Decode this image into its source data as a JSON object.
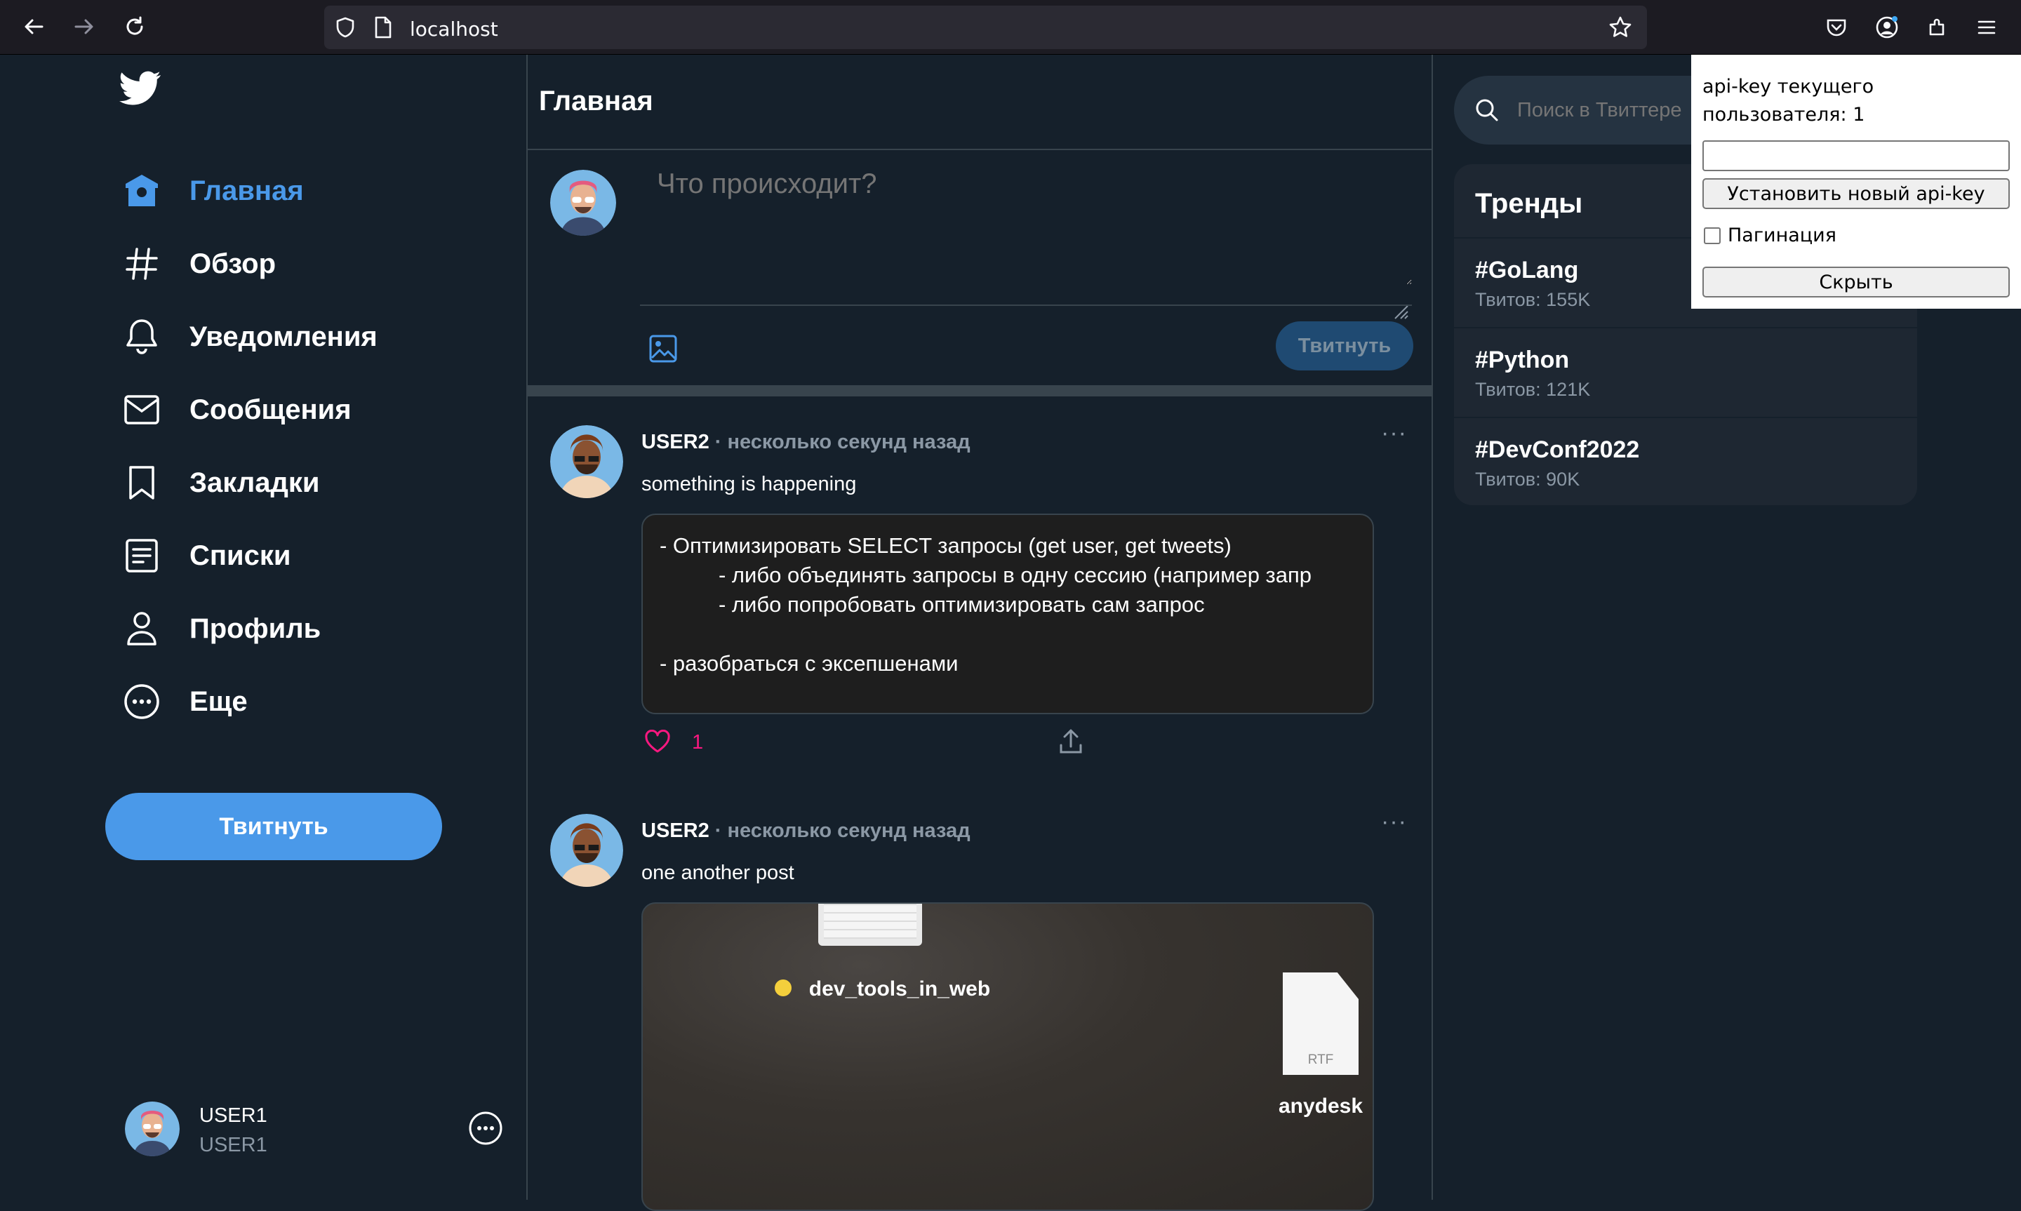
{
  "browser": {
    "url": "localhost"
  },
  "sidebar": {
    "logo_icon": "twitter-bird-icon",
    "items": [
      {
        "label": "Главная",
        "icon": "home-icon",
        "active": true
      },
      {
        "label": "Обзор",
        "icon": "hashtag-icon"
      },
      {
        "label": "Уведомления",
        "icon": "bell-icon"
      },
      {
        "label": "Сообщения",
        "icon": "mail-icon"
      },
      {
        "label": "Закладки",
        "icon": "bookmark-icon"
      },
      {
        "label": "Списки",
        "icon": "list-icon"
      },
      {
        "label": "Профиль",
        "icon": "user-icon"
      },
      {
        "label": "Еще",
        "icon": "more-circle-icon"
      }
    ],
    "tweet_button": "Твитнуть",
    "user": {
      "name": "USER1",
      "handle": "USER1"
    }
  },
  "main": {
    "title": "Главная",
    "compose": {
      "placeholder": "Что происходит?",
      "submit_label": "Твитнуть"
    },
    "posts": [
      {
        "author": "USER2",
        "time": "несколько секунд назад",
        "text": "something is happening",
        "likes": "1",
        "image_lines": [
          "- Оптимизировать SELECT запросы (get user, get tweets)",
          "- либо объединять запросы в одну сессию (например запр",
          "- либо попробовать оптимизировать сам запрос",
          "- разобраться с эксепшенами"
        ]
      },
      {
        "author": "USER2",
        "time": "несколько секунд назад",
        "text": "one another post",
        "image_labels": {
          "folder": "dev_tools_in_web",
          "file_type": "RTF",
          "file_name": "anydesk"
        }
      }
    ]
  },
  "right": {
    "search_placeholder": "Поиск в Твиттере",
    "trends_title": "Тренды",
    "trends": [
      {
        "tag": "#GoLang",
        "count": "Твитов: 155K"
      },
      {
        "tag": "#Python",
        "count": "Твитов: 121K"
      },
      {
        "tag": "#DevConf2022",
        "count": "Твитов: 90K"
      }
    ]
  },
  "popup": {
    "label": "api-key текущего пользователя: 1",
    "input_value": "",
    "set_button": "Установить новый api-key",
    "pagination_label": "Пагинация",
    "pagination_checked": false,
    "hide_button": "Скрыть"
  },
  "colors": {
    "accent": "#4a99e9",
    "background": "#15202b",
    "like": "#f91880"
  }
}
